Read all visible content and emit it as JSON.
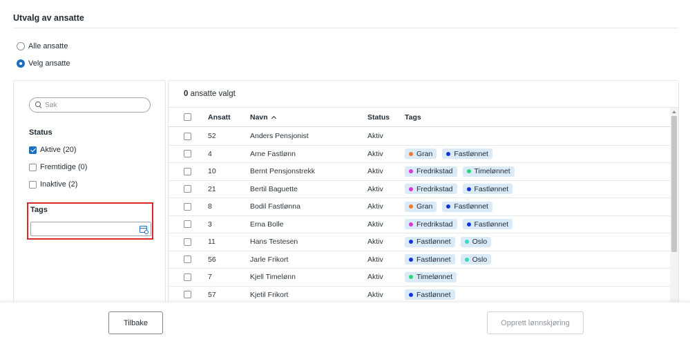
{
  "page": {
    "title": "Utvalg av ansatte"
  },
  "selection_mode": {
    "options": [
      {
        "label": "Alle ansatte",
        "selected": false
      },
      {
        "label": "Velg ansatte",
        "selected": true
      }
    ]
  },
  "filters": {
    "search_placeholder": "Søk",
    "status_heading": "Status",
    "status_options": [
      {
        "label": "Aktive (20)",
        "checked": true
      },
      {
        "label": "Fremtidige (0)",
        "checked": false
      },
      {
        "label": "Inaktive (2)",
        "checked": false
      }
    ],
    "tags_heading": "Tags",
    "tags_value": ""
  },
  "table": {
    "selected_count": "0",
    "selected_suffix": " ansatte valgt",
    "columns": {
      "id": "Ansatt",
      "name": "Navn",
      "status": "Status",
      "tags": "Tags"
    },
    "rows": [
      {
        "id": "52",
        "name": "Anders Pensjonist",
        "status": "Aktiv",
        "tags": []
      },
      {
        "id": "4",
        "name": "Arne Fastlønn",
        "status": "Aktiv",
        "tags": [
          {
            "label": "Gran",
            "color": "#f07a2a"
          },
          {
            "label": "Fastlønnet",
            "color": "#1433d6"
          }
        ]
      },
      {
        "id": "10",
        "name": "Bernt Pensjonstrekk",
        "status": "Aktiv",
        "tags": [
          {
            "label": "Fredrikstad",
            "color": "#d63ad6"
          },
          {
            "label": "Timelønnet",
            "color": "#27d67a"
          }
        ]
      },
      {
        "id": "21",
        "name": "Bertil Baguette",
        "status": "Aktiv",
        "tags": [
          {
            "label": "Fredrikstad",
            "color": "#d63ad6"
          },
          {
            "label": "Fastlønnet",
            "color": "#1433d6"
          }
        ]
      },
      {
        "id": "8",
        "name": "Bodil Fastlønna",
        "status": "Aktiv",
        "tags": [
          {
            "label": "Gran",
            "color": "#f07a2a"
          },
          {
            "label": "Fastlønnet",
            "color": "#1433d6"
          }
        ]
      },
      {
        "id": "3",
        "name": "Erna Bolle",
        "status": "Aktiv",
        "tags": [
          {
            "label": "Fredrikstad",
            "color": "#d63ad6"
          },
          {
            "label": "Fastlønnet",
            "color": "#1433d6"
          }
        ]
      },
      {
        "id": "11",
        "name": "Hans Testesen",
        "status": "Aktiv",
        "tags": [
          {
            "label": "Fastlønnet",
            "color": "#1433d6"
          },
          {
            "label": "Oslo",
            "color": "#3ad6c8"
          }
        ]
      },
      {
        "id": "56",
        "name": "Jarle Frikort",
        "status": "Aktiv",
        "tags": [
          {
            "label": "Fastlønnet",
            "color": "#1433d6"
          },
          {
            "label": "Oslo",
            "color": "#3ad6c8"
          }
        ]
      },
      {
        "id": "7",
        "name": "Kjell Timelønn",
        "status": "Aktiv",
        "tags": [
          {
            "label": "Timelønnet",
            "color": "#27d67a"
          }
        ]
      },
      {
        "id": "57",
        "name": "Kjetil Frikort",
        "status": "Aktiv",
        "tags": [
          {
            "label": "Fastlønnet",
            "color": "#1433d6"
          }
        ]
      }
    ]
  },
  "footer": {
    "back_label": "Tilbake",
    "create_label": "Opprett lønnskjøring"
  }
}
